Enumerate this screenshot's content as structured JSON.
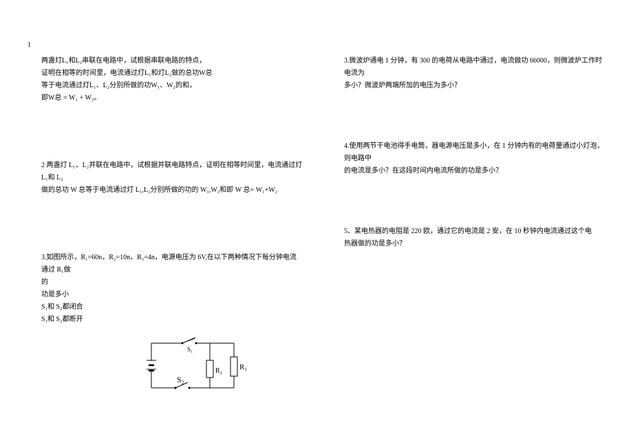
{
  "page_number": "1",
  "left": {
    "p1": {
      "l1": "两盏灯L₁和L₂串联在电路中，试根据串联电路的特点，",
      "l2": "证明在相等的时间里，电流通过灯L₁和灯L₂做的总功W总",
      "l3": "等于电流通过灯L₁、L₂分别所做的功W₁、W₂的和，",
      "l4": "即W总 = W₁ + W₂。"
    },
    "p2": {
      "l1": "2 两盏灯 L₁、L₂并联在电路中，试根据并联电路特点，证明在相等时间里，电流通过灯 L₁和 L₂",
      "l2": "做的总功 W 总等于电流通过灯 L₁,L₂分别所做的功的 W₁,W₂和即 W 总= W₁+W₂"
    },
    "p3": {
      "l1": "3.如图所示，R₁=60n，R₂=10n，R₃=4n，电源电压为 6V,在以下两种情况下每分钟电流通过 R₁做",
      "l2": "的",
      "l3": "功是多小",
      "l4": "S₁和 S₂都闭合",
      "l5": "S₁和 S₂都断开"
    },
    "circuit": {
      "S1": "S₁",
      "S2": "S₂",
      "R1": "R₁",
      "R2": "R₂"
    }
  },
  "right": {
    "p3": {
      "l1": "3.微波炉通电 1 分钟，有 300 的电荷从电路中通过，电流做功 66000，则微波炉工作时电流为",
      "l2": "多小？微波炉两端所加的电压为多小？"
    },
    "p4": {
      "l1": "4.使用两节干电池得手电筒，器电源电压是多小，在 1 分钟内有的电荷量通过小灯泡，则电路中",
      "l2": "的电流是多小？在这段时间内电流所做的功是多小？"
    },
    "p5": {
      "l1": "5、某电热器的电阻是 220 欧，通过它的电流是 2 安，在 10 秒钟内电流通过这个电",
      "l2": "热器做的功是多小？"
    }
  }
}
